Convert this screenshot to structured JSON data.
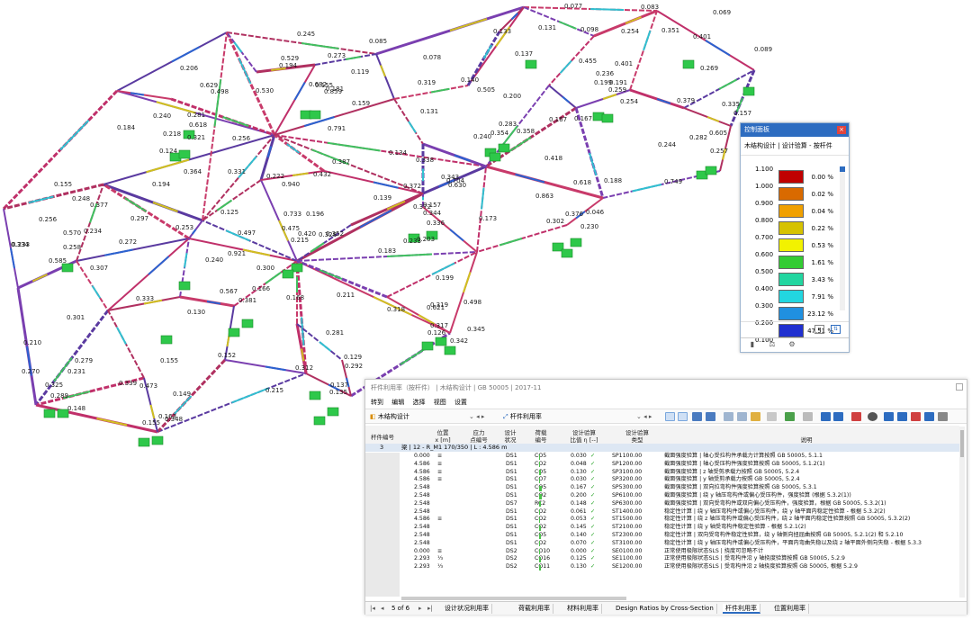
{
  "model_labels": [
    "0.245",
    "0.085",
    "0.133",
    "0.137",
    "0.131",
    "0.098",
    "0.077",
    "0.083",
    "0.069",
    "0.401",
    "0.089",
    "0.206",
    "0.529",
    "0.194",
    "0.273",
    "0.078",
    "0.119",
    "0.140",
    "0.155",
    "0.181",
    "0.254",
    "0.351",
    "0.629",
    "0.498",
    "0.530",
    "0.682",
    "0.859",
    "0.319",
    "0.505",
    "0.455",
    "0.401",
    "0.269",
    "0.184",
    "0.240",
    "0.281",
    "0.618",
    "0.218",
    "0.321",
    "0.256",
    "0.791",
    "0.131",
    "0.159",
    "0.200",
    "0.236",
    "0.199",
    "0.191",
    "0.259",
    "0.254",
    "0.379",
    "0.335",
    "0.157",
    "0.124",
    "0.364",
    "0.331",
    "0.222",
    "0.940",
    "0.432",
    "0.387",
    "0.134",
    "0.338",
    "0.343",
    "0.372",
    "0.283",
    "0.358",
    "0.354",
    "0.240",
    "0.167",
    "0.167",
    "0.244",
    "0.282",
    "0.605",
    "0.257",
    "0.155",
    "0.194",
    "0.248",
    "0.377",
    "0.125",
    "0.253",
    "0.704",
    "0.630",
    "0.233",
    "0.157",
    "0.344",
    "0.372",
    "0.139",
    "0.418",
    "0.188",
    "0.749",
    "0.863",
    "0.618",
    "0.256",
    "0.297",
    "0.570",
    "0.234",
    "0.733",
    "0.475",
    "0.196",
    "0.336",
    "0.173",
    "0.328",
    "0.376",
    "0.046",
    "0.233",
    "0.334",
    "0.272",
    "0.258",
    "0.497",
    "0.420",
    "0.215",
    "0.352",
    "0.203",
    "0.302",
    "0.230",
    "0.585",
    "0.307",
    "0.240",
    "0.921",
    "0.319",
    "0.300",
    "0.183",
    "0.199",
    "0.567",
    "0.166",
    "0.333",
    "0.381",
    "0.168",
    "0.211",
    "0.318",
    "0.498",
    "0.301",
    "0.130",
    "0.621",
    "0.210",
    "0.281",
    "0.317",
    "0.345",
    "0.126",
    "0.342",
    "0.279",
    "0.155",
    "0.152",
    "0.215",
    "0.270",
    "0.231",
    "0.339",
    "0.473",
    "0.129",
    "0.292",
    "0.325",
    "0.289",
    "0.312",
    "0.135",
    "0.137",
    "0.149",
    "0.148",
    "0.155",
    "0.348",
    "0.163"
  ],
  "control_panel": {
    "title": "控制面板",
    "close": "×",
    "subtitle": "木结构设计 | 设计验算 - 按杆件",
    "legend": [
      {
        "value": "1.100",
        "color": "#c00000",
        "pct": "0.00 %"
      },
      {
        "value": "1.000",
        "color": "#d96a00",
        "pct": "0.02 %"
      },
      {
        "value": "0.900",
        "color": "#f0a000",
        "pct": "0.04 %"
      },
      {
        "value": "0.800",
        "color": "#d6c200",
        "pct": "0.22 %"
      },
      {
        "value": "0.700",
        "color": "#f2f200",
        "pct": "0.53 %"
      },
      {
        "value": "0.600",
        "color": "#33cc33",
        "pct": "1.61 %"
      },
      {
        "value": "0.500",
        "color": "#22d6a0",
        "pct": "3.43 %"
      },
      {
        "value": "0.400",
        "color": "#22d6e0",
        "pct": "7.91 %"
      },
      {
        "value": "0.300",
        "color": "#2090e0",
        "pct": "23.12 %"
      },
      {
        "value": "0.200",
        "color": "#2030d0",
        "pct": "47.51 %"
      },
      {
        "value": "0.100",
        "color": "#5a1a9a",
        "pct": ""
      }
    ]
  },
  "results": {
    "title": "杆件利用率（按杆件） | 木结构设计 | GB 50005 | 2017-11",
    "menu": [
      "转到",
      "编辑",
      "选择",
      "视图",
      "设置"
    ],
    "combo_module": "木结构设计",
    "combo_table": "杆件利用率",
    "headers": {
      "member_no": "杆件编号",
      "location": "位置\nx [m]",
      "stress_point": "应力\n点编号",
      "design_situation": "设计\n状况",
      "loading": "荷载\n编号",
      "ratio": "设计验算\n比值 η [--]",
      "check_type": "设计验算\n类型",
      "description": "说明"
    },
    "group_row": {
      "member": "3",
      "label": "梁 | 12 - R_M1 170/350 | L : 4.586 m"
    },
    "rows": [
      {
        "loc": "0.000",
        "m": "≡",
        "ds": "DS1",
        "co": "CO5",
        "ratio": "0.030",
        "type": "SP1100.00",
        "desc": "截面强度验算 | 轴心受拉构件承载力计算按照 GB 50005, 5.1.1"
      },
      {
        "loc": "4.586",
        "m": "≡",
        "ds": "DS1",
        "co": "CO2",
        "ratio": "0.048",
        "type": "SP1200.00",
        "desc": "截面强度验算 | 轴心受压构件强度验算按照 GB 50005, 5.1.2(1)"
      },
      {
        "loc": "4.586",
        "m": "≡",
        "ds": "DS1",
        "co": "CO5",
        "ratio": "0.130",
        "type": "SP3100.00",
        "desc": "截面强度验算 | z 轴受剪承载力按照 GB 50005, 5.2.4"
      },
      {
        "loc": "4.586",
        "m": "≡",
        "ds": "DS1",
        "co": "CO7",
        "ratio": "0.030",
        "type": "SP3200.00",
        "desc": "截面强度验算 | y 轴受剪承载力按照 GB 50005, 5.2.4"
      },
      {
        "loc": "2.548",
        "m": "",
        "ds": "DS1",
        "co": "CO5",
        "ratio": "0.167",
        "type": "SP5300.00",
        "desc": "截面强度验算 | 双向拉弯构件强度验算按照 GB 50005, 5.3.1"
      },
      {
        "loc": "2.548",
        "m": "",
        "ds": "DS1",
        "co": "CO2",
        "ratio": "0.200",
        "type": "SP6100.00",
        "desc": "截面强度验算 | 绕 y 轴压弯构件或偏心受压构件，强度验算 (根据 5.3.2(1))"
      },
      {
        "loc": "2.548",
        "m": "",
        "ds": "DS7",
        "co": "RC2",
        "ratio": "0.148",
        "type": "SP6300.00",
        "desc": "截面强度验算 | 双向受弯构件或双向偏心受压构件，强度验算，根据 GB 50005, 5.3.2(1)"
      },
      {
        "loc": "2.548",
        "m": "",
        "ds": "DS1",
        "co": "CO2",
        "ratio": "0.061",
        "type": "ST1400.00",
        "desc": "稳定性计算 | 绕 y 轴压弯构件或偏心受压构件，绕 y 轴平面内稳定性验算 - 根据 5.3.2(2)"
      },
      {
        "loc": "4.586",
        "m": "≡",
        "ds": "DS1",
        "co": "CO2",
        "ratio": "0.053",
        "type": "ST1500.00",
        "desc": "稳定性计算 | 绕 z 轴压弯构件或偏心受压构件，绕 z 轴平面内稳定性验算按照 GB 50005, 5.3.2(2)"
      },
      {
        "loc": "2.548",
        "m": "",
        "ds": "DS1",
        "co": "CO2",
        "ratio": "0.145",
        "type": "ST2100.00",
        "desc": "稳定性计算 | 绕 y 轴受弯构件稳定性验算 - 根据 5.2.1(2)"
      },
      {
        "loc": "2.548",
        "m": "",
        "ds": "DS1",
        "co": "CO5",
        "ratio": "0.140",
        "type": "ST2300.00",
        "desc": "稳定性计算 | 双向受弯构件稳定性验算，绕 y 轴侧向扭屈曲按照 GB 50005, 5.2.1(2) 和 5.2.10"
      },
      {
        "loc": "2.548",
        "m": "",
        "ds": "DS1",
        "co": "CO2",
        "ratio": "0.070",
        "type": "ST3100.00",
        "desc": "稳定性计算 | 绕 y 轴压弯构件或偏心受压构件，平面内弯曲失稳以及绕 z 轴平面外侧向失稳 - 根据 5.3.3"
      },
      {
        "loc": "0.000",
        "m": "≡",
        "ds": "DS2",
        "co": "CO10",
        "ratio": "0.000",
        "type": "SE0100.00",
        "desc": "正常使用极限状态SLS | 挠度可忽略不计"
      },
      {
        "loc": "2.293",
        "m": "⅓",
        "ds": "DS2",
        "co": "CO16",
        "ratio": "0.125",
        "type": "SE1100.00",
        "desc": "正常使用极限状态SLS | 受弯构件沿 y 轴挠度验算按照 GB 50005, 5.2.9"
      },
      {
        "loc": "2.293",
        "m": "⅓",
        "ds": "DS2",
        "co": "CO11",
        "ratio": "0.130",
        "type": "SE1200.00",
        "desc": "正常使用极限状态SLS | 受弯构件沿 z 轴挠度验算按照 GB 50005, 根据 5.2.9"
      }
    ],
    "pager": "5 of 6",
    "sheets": [
      "设计状况利用率",
      "荷载利用率",
      "材料利用率",
      "Design Ratios by Cross-Section",
      "杆件利用率",
      "位置利用率"
    ],
    "active_sheet": 4
  }
}
